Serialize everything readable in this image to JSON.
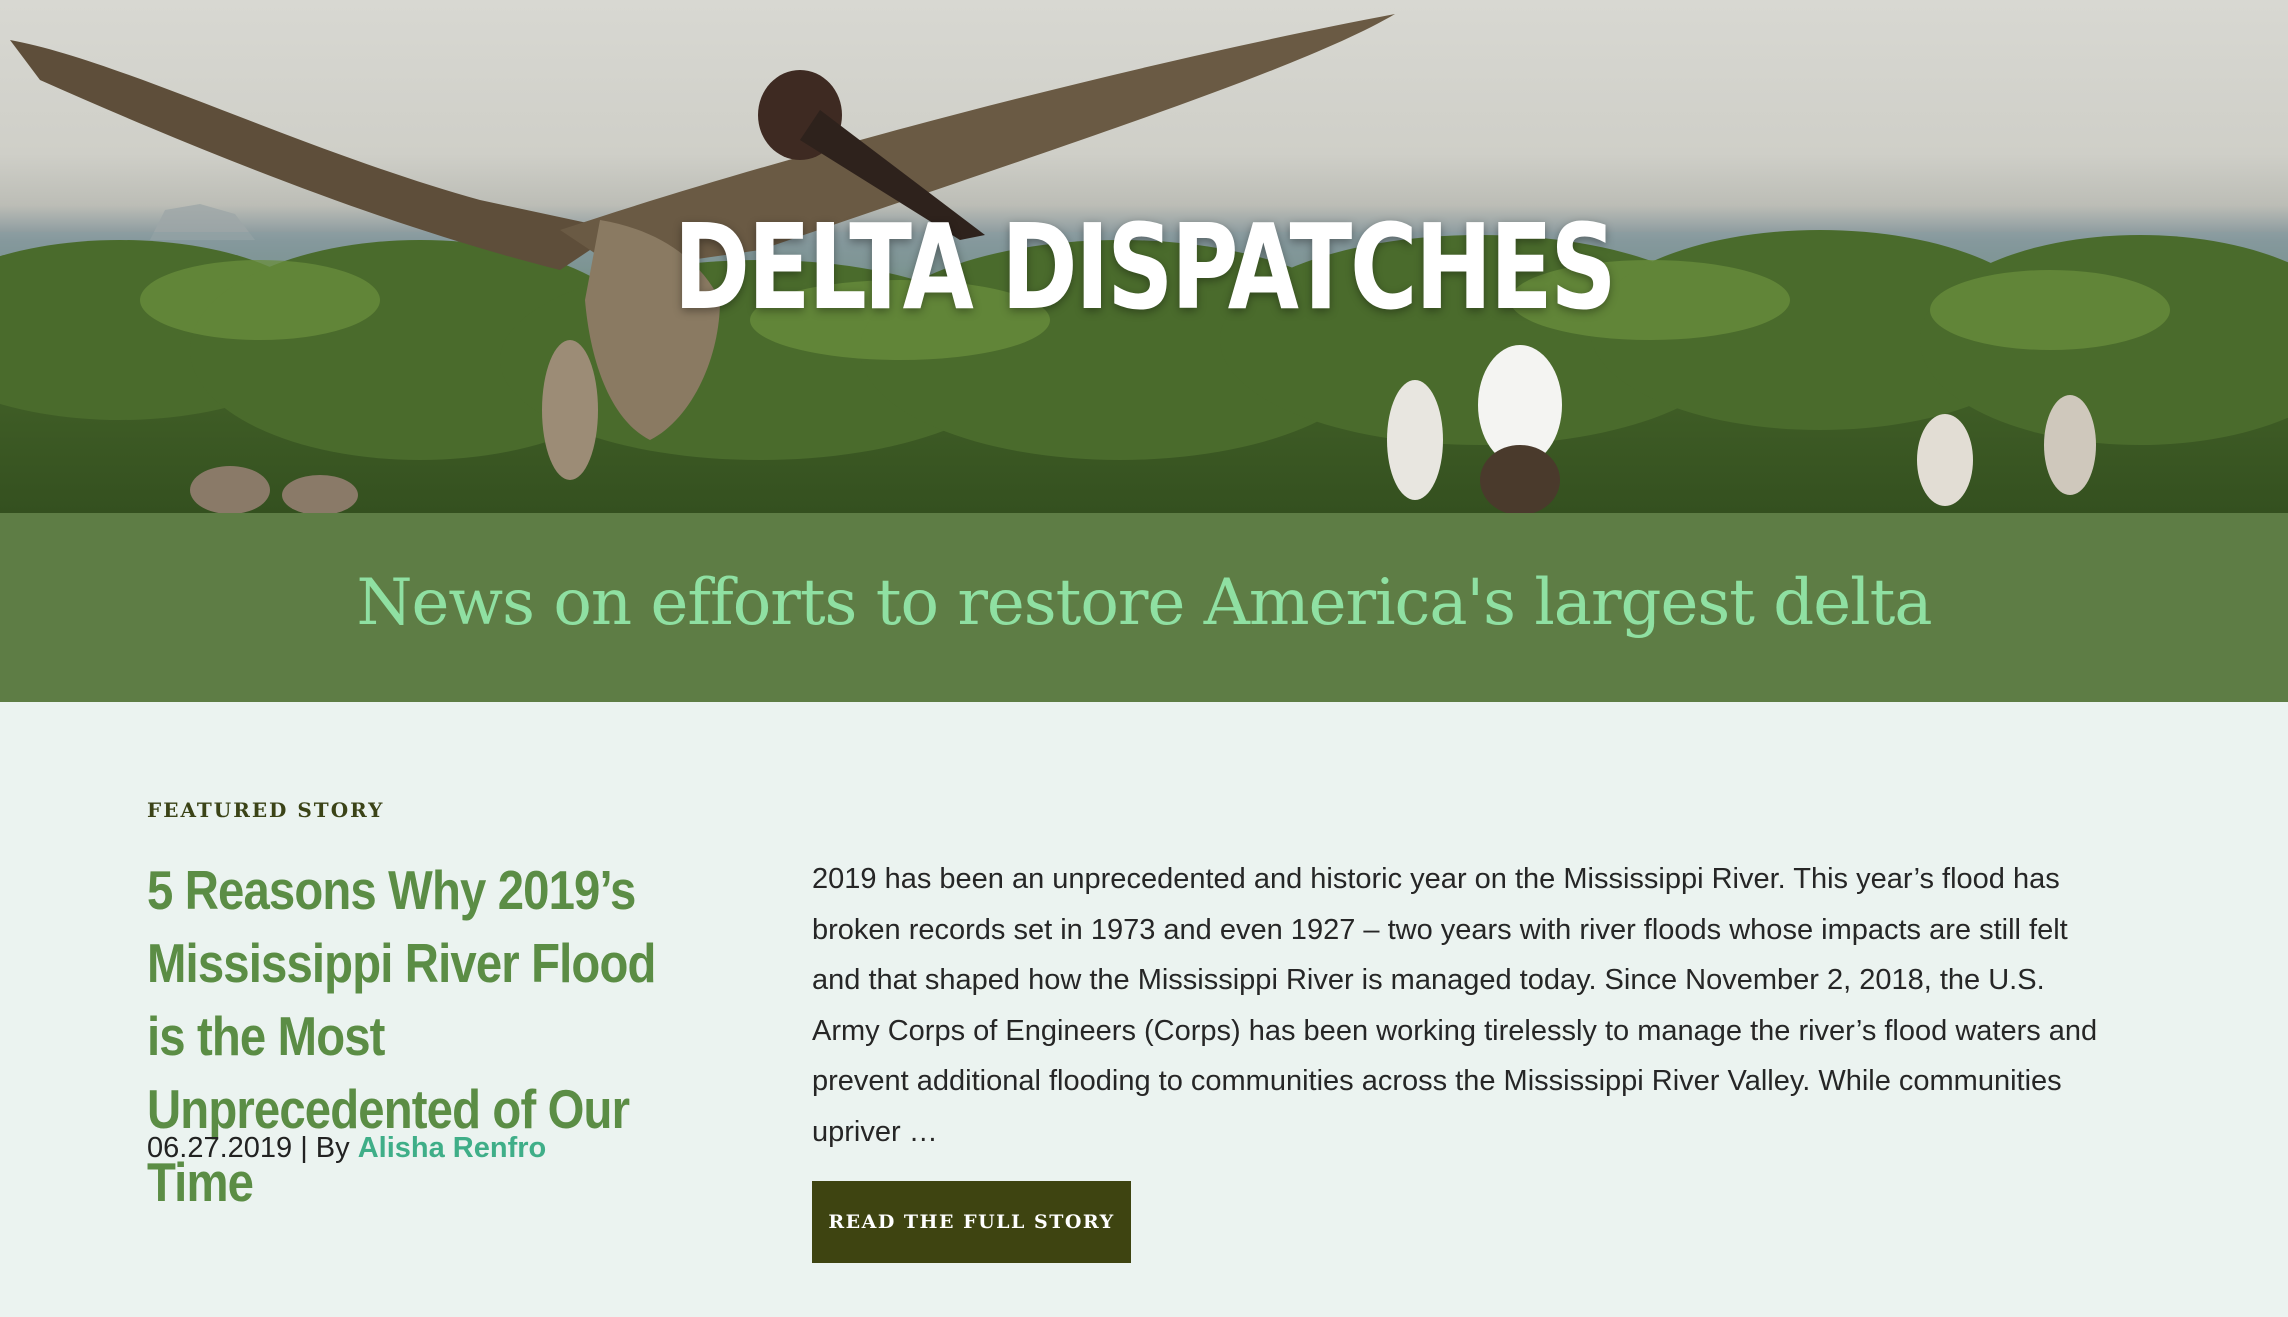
{
  "hero": {
    "title": "DELTA DISPATCHES",
    "image": "pelicans-and-egrets-on-mangrove-island"
  },
  "tagline": "News on efforts to restore America's largest delta",
  "featured": {
    "eyebrow": "FEATURED STORY",
    "title": "5 Reasons Why 2019’s Mississippi River Flood is the Most Unprecedented of Our Time",
    "date": "06.27.2019",
    "by_separator": " | By ",
    "author": "Alisha Renfro",
    "excerpt": "2019 has been an unprecedented and historic year on the Mississippi River. This year’s flood has broken records set in 1973 and even 1927 – two years with river floods whose impacts are still felt and that shaped how the Mississippi River is managed today. Since November 2, 2018, the U.S. Army Corps of Engineers (Corps) has been working tirelessly to manage the river’s flood waters and prevent additional flooding to communities across the Mississippi River Valley. While communities upriver …",
    "button_label": "READ THE FULL STORY"
  },
  "colors": {
    "band": "#5e7d45",
    "tagline": "#8fe0a2",
    "title_green": "#5b8d45",
    "author_link": "#3fae88",
    "button": "#3e4411",
    "page_bg": "#ebf3f0"
  }
}
